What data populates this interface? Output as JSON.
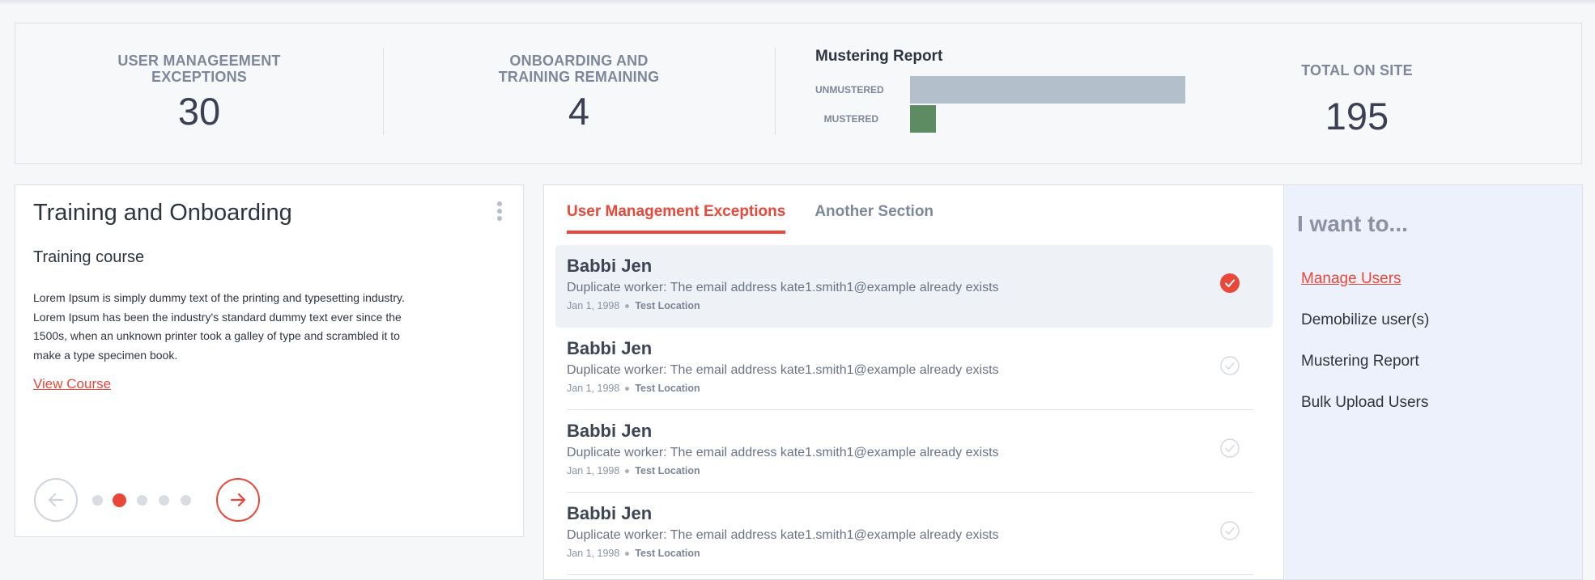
{
  "stats": {
    "user_exceptions": {
      "label_line1": "USER MANAGEEMENT",
      "label_line2": "EXCEPTIONS",
      "value": "30"
    },
    "onboarding": {
      "label_line1": "ONBOARDING AND",
      "label_line2": "TRAINING REMAINING",
      "value": "4"
    },
    "total_on_site": {
      "label": "TOTAL ON SITE",
      "value": "195"
    }
  },
  "mustering_report": {
    "title": "Mustering Report",
    "bars": [
      {
        "label": "UNMUSTERED",
        "fraction": 0.8,
        "color": "#b3c0cc"
      },
      {
        "label": "MUSTERED",
        "fraction": 0.075,
        "color": "#5d8c62"
      }
    ]
  },
  "training_card": {
    "title": "Training and Onboarding",
    "course_title": "Training course",
    "course_body": "Lorem Ipsum is simply dummy text of the printing and typesetting industry. Lorem Ipsum has been the industry's standard dummy text ever since the 1500s, when an unknown printer took a galley of type and scrambled it to make a type specimen book.",
    "link_label": "View Course",
    "pagination": {
      "total": 5,
      "active": 2
    }
  },
  "exceptions": {
    "tabs": [
      {
        "label": "User Management Exceptions",
        "active": true
      },
      {
        "label": "Another Section",
        "active": false
      }
    ],
    "items": [
      {
        "name": "Babbi Jen",
        "description": "Duplicate worker: The email address kate1.smith1@example already exists",
        "date": "Jan 1, 1998",
        "location": "Test Location",
        "checked": true
      },
      {
        "name": "Babbi Jen",
        "description": "Duplicate worker: The email address kate1.smith1@example already exists",
        "date": "Jan 1, 1998",
        "location": "Test Location",
        "checked": false
      },
      {
        "name": "Babbi Jen",
        "description": "Duplicate worker: The email address kate1.smith1@example already exists",
        "date": "Jan 1, 1998",
        "location": "Test Location",
        "checked": false
      },
      {
        "name": "Babbi Jen",
        "description": "Duplicate worker: The email address kate1.smith1@example already exists",
        "date": "Jan 1, 1998",
        "location": "Test Location",
        "checked": false
      }
    ]
  },
  "i_want_to": {
    "title": "I want to...",
    "actions": [
      {
        "label": "Manage Users",
        "active": true
      },
      {
        "label": "Demobilize user(s)",
        "active": false
      },
      {
        "label": "Mustering Report",
        "active": false
      },
      {
        "label": "Bulk Upload Users",
        "active": false
      }
    ]
  },
  "colors": {
    "accent": "#e8473a",
    "muted_text": "#7e879a",
    "panel_tint": "#edf1fb"
  }
}
